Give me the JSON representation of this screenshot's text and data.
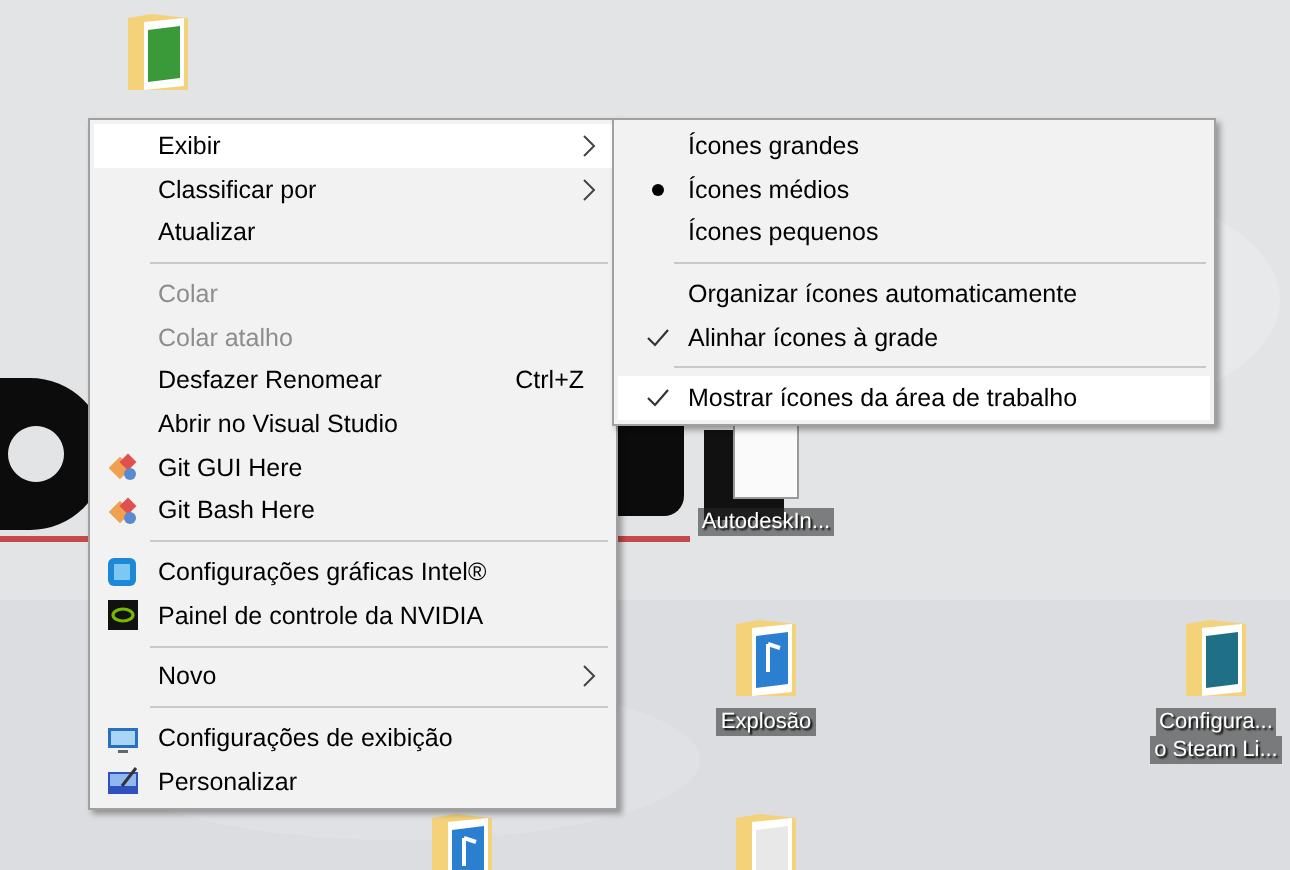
{
  "desktop_icons": [
    {
      "kind": "folder-green"
    },
    {
      "kind": "app",
      "label": [
        "AutodeskIn..."
      ]
    },
    {
      "kind": "folder-music",
      "label": [
        "Explosão"
      ]
    },
    {
      "kind": "folder-teal",
      "label": [
        "Configura...",
        "o Steam Li..."
      ]
    },
    {
      "kind": "folder-music"
    },
    {
      "kind": "folder-plain"
    }
  ],
  "context_menu": {
    "items": [
      {
        "kind": "item",
        "label": "Exibir",
        "submenu": true,
        "highlighted": true,
        "disabled": false
      },
      {
        "kind": "item",
        "label": "Classificar por",
        "submenu": true,
        "highlighted": false,
        "disabled": false
      },
      {
        "kind": "item",
        "label": "Atualizar",
        "submenu": false,
        "highlighted": false,
        "disabled": false
      },
      {
        "kind": "separator"
      },
      {
        "kind": "item",
        "label": "Colar",
        "submenu": false,
        "highlighted": false,
        "disabled": true
      },
      {
        "kind": "item",
        "label": "Colar atalho",
        "submenu": false,
        "highlighted": false,
        "disabled": true
      },
      {
        "kind": "item",
        "label": "Desfazer Renomear",
        "shortcut": "Ctrl+Z",
        "submenu": false,
        "highlighted": false,
        "disabled": false
      },
      {
        "kind": "item",
        "label": "Abrir no Visual Studio",
        "submenu": false,
        "highlighted": false,
        "disabled": false
      },
      {
        "kind": "item",
        "label": "Git GUI Here",
        "submenu": false,
        "highlighted": false,
        "disabled": false
      },
      {
        "kind": "item",
        "label": "Git Bash Here",
        "submenu": false,
        "highlighted": false,
        "disabled": false
      },
      {
        "kind": "separator"
      },
      {
        "kind": "item",
        "label": "Configurações gráficas Intel®",
        "submenu": false,
        "highlighted": false,
        "disabled": false
      },
      {
        "kind": "item",
        "label": "Painel de controle da NVIDIA",
        "submenu": false,
        "highlighted": false,
        "disabled": false
      },
      {
        "kind": "separator"
      },
      {
        "kind": "item",
        "label": "Novo",
        "submenu": true,
        "highlighted": false,
        "disabled": false
      },
      {
        "kind": "separator"
      },
      {
        "kind": "item",
        "label": "Configurações de exibição",
        "submenu": false,
        "highlighted": false,
        "disabled": false
      },
      {
        "kind": "item",
        "label": "Personalizar",
        "submenu": false,
        "highlighted": false,
        "disabled": false
      }
    ]
  },
  "submenu": {
    "items": [
      {
        "kind": "radio",
        "label": "Ícones grandes",
        "selected": false,
        "highlighted": false
      },
      {
        "kind": "radio",
        "label": "Ícones médios",
        "selected": true,
        "highlighted": false
      },
      {
        "kind": "radio",
        "label": "Ícones pequenos",
        "selected": false,
        "highlighted": false
      },
      {
        "kind": "separator"
      },
      {
        "kind": "check",
        "label": "Organizar ícones automaticamente",
        "checked": false,
        "highlighted": false
      },
      {
        "kind": "check",
        "label": "Alinhar ícones à grade",
        "checked": true,
        "highlighted": false
      },
      {
        "kind": "separator"
      },
      {
        "kind": "check",
        "label": "Mostrar ícones da área de trabalho",
        "checked": true,
        "highlighted": true
      }
    ]
  }
}
